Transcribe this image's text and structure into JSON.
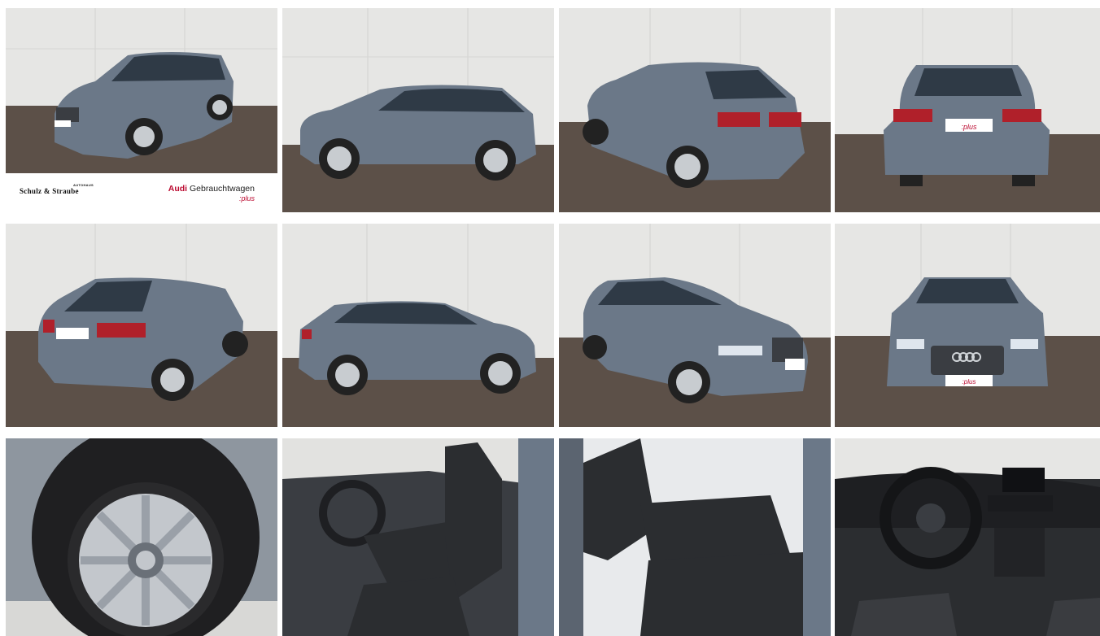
{
  "gallery": {
    "banner": {
      "dealer_name": "Schulz & Straube",
      "dealer_tagline": "AUTOHAUS",
      "brand_word": "Audi",
      "brand_rest": "Gebrauchtwagen",
      "brand_plus": ":plus"
    },
    "plate": {
      "text": ":plus"
    },
    "photos": [
      {
        "view": "front-three-quarter-left"
      },
      {
        "view": "side-left"
      },
      {
        "view": "rear-three-quarter-left"
      },
      {
        "view": "rear"
      },
      {
        "view": "rear-three-quarter-right"
      },
      {
        "view": "side-right"
      },
      {
        "view": "front-three-quarter-right"
      },
      {
        "view": "front"
      },
      {
        "view": "wheel"
      },
      {
        "view": "front-seats"
      },
      {
        "view": "rear-seats"
      },
      {
        "view": "cockpit"
      }
    ],
    "colors": {
      "car_body": "#6b7888",
      "wall": "#e6e6e4",
      "ground": "#5c5048",
      "tail_light": "#b0202a",
      "audi_red": "#bb0a30",
      "interior": "#2b2d30"
    }
  }
}
